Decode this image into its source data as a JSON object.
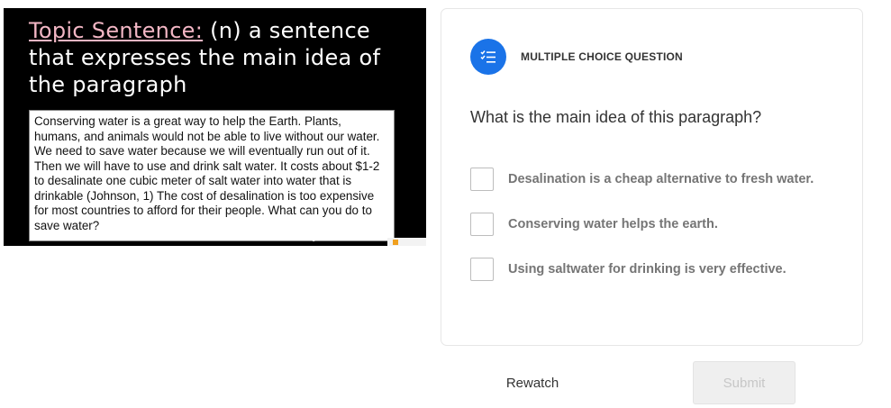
{
  "video": {
    "title_term": "Topic Sentence:",
    "title_rest": " (n) a sentence that expresses the main idea of the paragraph",
    "paragraph": "Conserving water is a great way to help the Earth. Plants, humans, and animals would not be able to live without our water. We need to save water because we will eventually run out of it. Then we will have to use and drink salt water. It costs about $1-2 to desalinate one cubic meter of salt water into water that is drinkable (Johnson, 1) The cost of desalination is too expensive for most countries to afford for their people. What can you do to save water?"
  },
  "question": {
    "type_icon": "list-checks-icon",
    "type_label": "MULTIPLE CHOICE QUESTION",
    "text": "What is the main idea of this paragraph?",
    "options": [
      {
        "label": "Desalination is a cheap alternative to fresh water."
      },
      {
        "label": "Conserving water helps the earth."
      },
      {
        "label": "Using saltwater for drinking is very effective."
      }
    ]
  },
  "actions": {
    "rewatch_label": "Rewatch",
    "submit_label": "Submit"
  },
  "colors": {
    "accent": "#1a73e8",
    "title_highlight": "#f2b6c4",
    "submit_disabled_bg": "#efefef"
  }
}
